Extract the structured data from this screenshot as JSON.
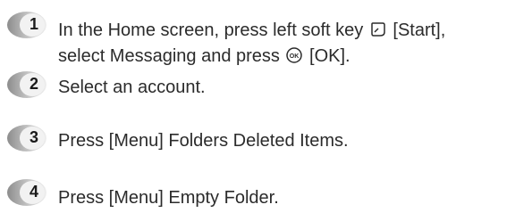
{
  "steps": [
    {
      "number": "1",
      "line1_a": "In the Home screen, press left soft key ",
      "line1_icon": "left-soft-key-icon",
      "line1_b": " [Start],",
      "line2_a": "select Messaging and press ",
      "line2_icon": "ok-key-icon",
      "line2_b": " [OK]."
    },
    {
      "number": "2",
      "text": "Select an account."
    },
    {
      "number": "3",
      "text": "Press [Menu] Folders Deleted Items."
    },
    {
      "number": "4",
      "text": "Press [Menu] Empty Folder."
    }
  ],
  "colors": {
    "badge_light": "#e6e6e6",
    "badge_dark": "#9a9a9a",
    "text": "#2b2b2b"
  }
}
